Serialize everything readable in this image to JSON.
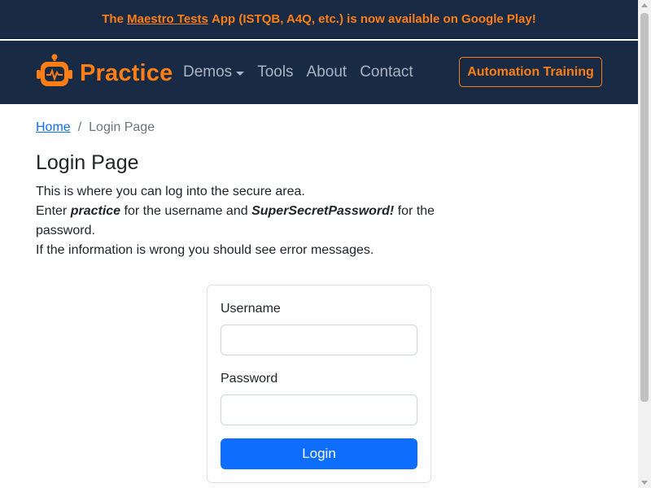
{
  "banner": {
    "prefix": "The",
    "link": "Maestro Tests",
    "suffix": "App (ISTQB, A4Q, etc.) is now available on Google Play!"
  },
  "navbar": {
    "brand": "Practice",
    "logo_icon": "robot-icon",
    "items": [
      {
        "label": "Demos",
        "dropdown": true
      },
      {
        "label": "Tools"
      },
      {
        "label": "About"
      },
      {
        "label": "Contact"
      }
    ],
    "cta": "Automation Training"
  },
  "breadcrumb": {
    "home": "Home",
    "separator": "/",
    "current": "Login Page"
  },
  "page": {
    "title": "Login Page",
    "line1": "This is where you can log into the secure area.",
    "line2_prefix": "Enter",
    "username_hint": "practice",
    "line2_mid": "for the username and",
    "password_hint": "SuperSecretPassword!",
    "line2_suffix": "for the password.",
    "line3": "If the information is wrong you should see error messages."
  },
  "form": {
    "username_label": "Username",
    "username_value": "",
    "password_label": "Password",
    "password_value": "",
    "submit": "Login"
  },
  "colors": {
    "navy": "#192a44",
    "accent": "#fd7e14",
    "primary": "#0d6efd"
  }
}
